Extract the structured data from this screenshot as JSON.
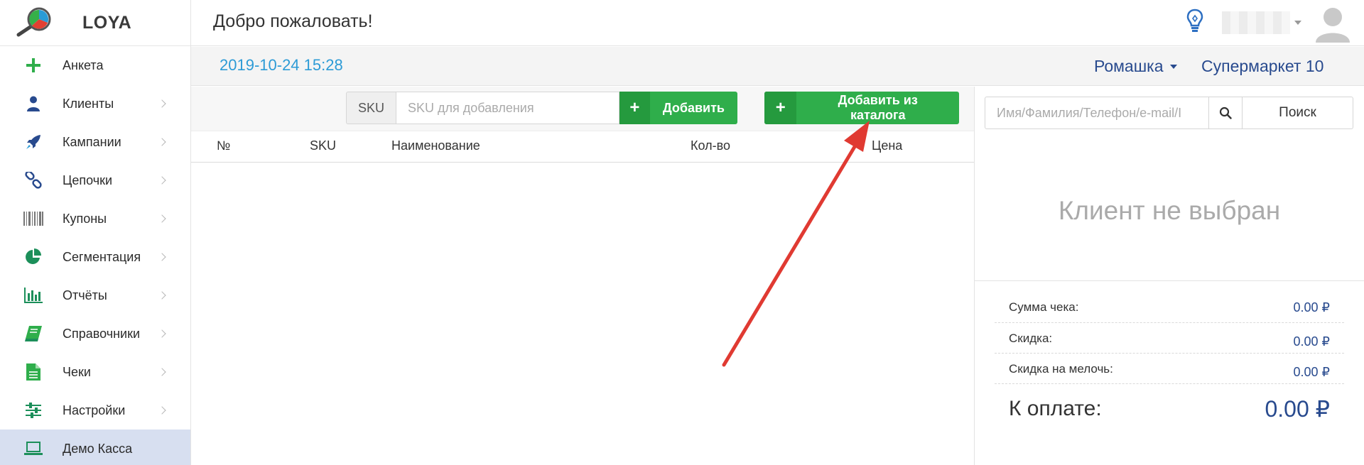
{
  "app": {
    "logo_text": "LOYA"
  },
  "header": {
    "welcome": "Добро пожаловать!"
  },
  "sidebar": {
    "items": [
      {
        "label": "Анкета",
        "icon": "plus-icon",
        "chevron": false
      },
      {
        "label": "Клиенты",
        "icon": "user-icon",
        "chevron": true
      },
      {
        "label": "Кампании",
        "icon": "rocket-icon",
        "chevron": true
      },
      {
        "label": "Цепочки",
        "icon": "chain-icon",
        "chevron": true
      },
      {
        "label": "Купоны",
        "icon": "barcode-icon",
        "chevron": true
      },
      {
        "label": "Сегментация",
        "icon": "pie-chart-icon",
        "chevron": true
      },
      {
        "label": "Отчёты",
        "icon": "bar-chart-icon",
        "chevron": true
      },
      {
        "label": "Справочники",
        "icon": "book-icon",
        "chevron": true
      },
      {
        "label": "Чеки",
        "icon": "document-icon",
        "chevron": true
      },
      {
        "label": "Настройки",
        "icon": "sliders-icon",
        "chevron": true
      },
      {
        "label": "Демо Касса",
        "icon": "laptop-icon",
        "chevron": false,
        "active": true
      }
    ]
  },
  "subheader": {
    "datetime": "2019-10-24 15:28",
    "store": "Ромашка",
    "shop": "Супермаркет 10"
  },
  "toolbar": {
    "sku_addon": "SKU",
    "sku_placeholder": "SKU для добавления",
    "add_label": "Добавить",
    "add_catalog_label": "Добавить из каталога",
    "plus": "+"
  },
  "table": {
    "columns": [
      "№",
      "SKU",
      "Наименование",
      "Кол-во",
      "Цена"
    ]
  },
  "client": {
    "search_placeholder": "Имя/Фамилия/Телефон/e-mail/I",
    "search_button": "Поиск",
    "empty_text": "Клиент не выбран"
  },
  "totals": {
    "sum_label": "Сумма чека:",
    "sum_value": "0.00 ₽",
    "discount_label": "Скидка:",
    "discount_value": "0.00 ₽",
    "change_discount_label": "Скидка на мелочь:",
    "change_discount_value": "0.00 ₽",
    "total_label": "К оплате:",
    "total_value": "0.00 ₽"
  },
  "colors": {
    "accent_green": "#2fae4b",
    "link_blue": "#284a8e",
    "datetime_blue": "#2d9bd6",
    "active_bg": "#d7dff0",
    "annotation_red": "#e03a32"
  }
}
